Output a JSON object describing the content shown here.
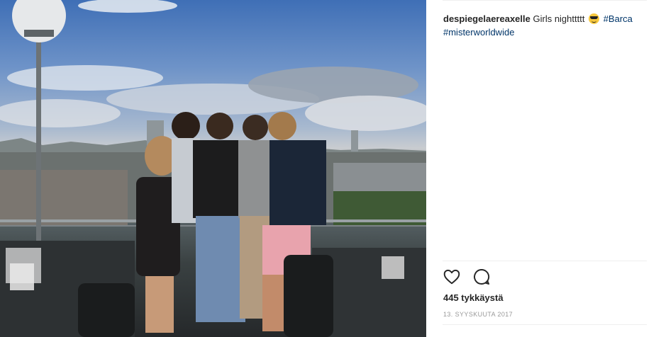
{
  "post": {
    "username": "despiegelaereaxelle",
    "caption_text": "Girls nighttttt",
    "emoji_icon": "sunglasses-emoji",
    "hashtags": [
      "#Barca",
      "#misterworldwide"
    ],
    "likes": "445 tykkäystä",
    "date": "13. SYYSKUUTA 2017"
  },
  "actions": {
    "like_icon": "heart-outline",
    "comment_icon": "speech-bubble-outline"
  },
  "colors": {
    "text": "#262626",
    "hashtag": "#003569",
    "muted": "#999999",
    "divider": "#efefef"
  }
}
